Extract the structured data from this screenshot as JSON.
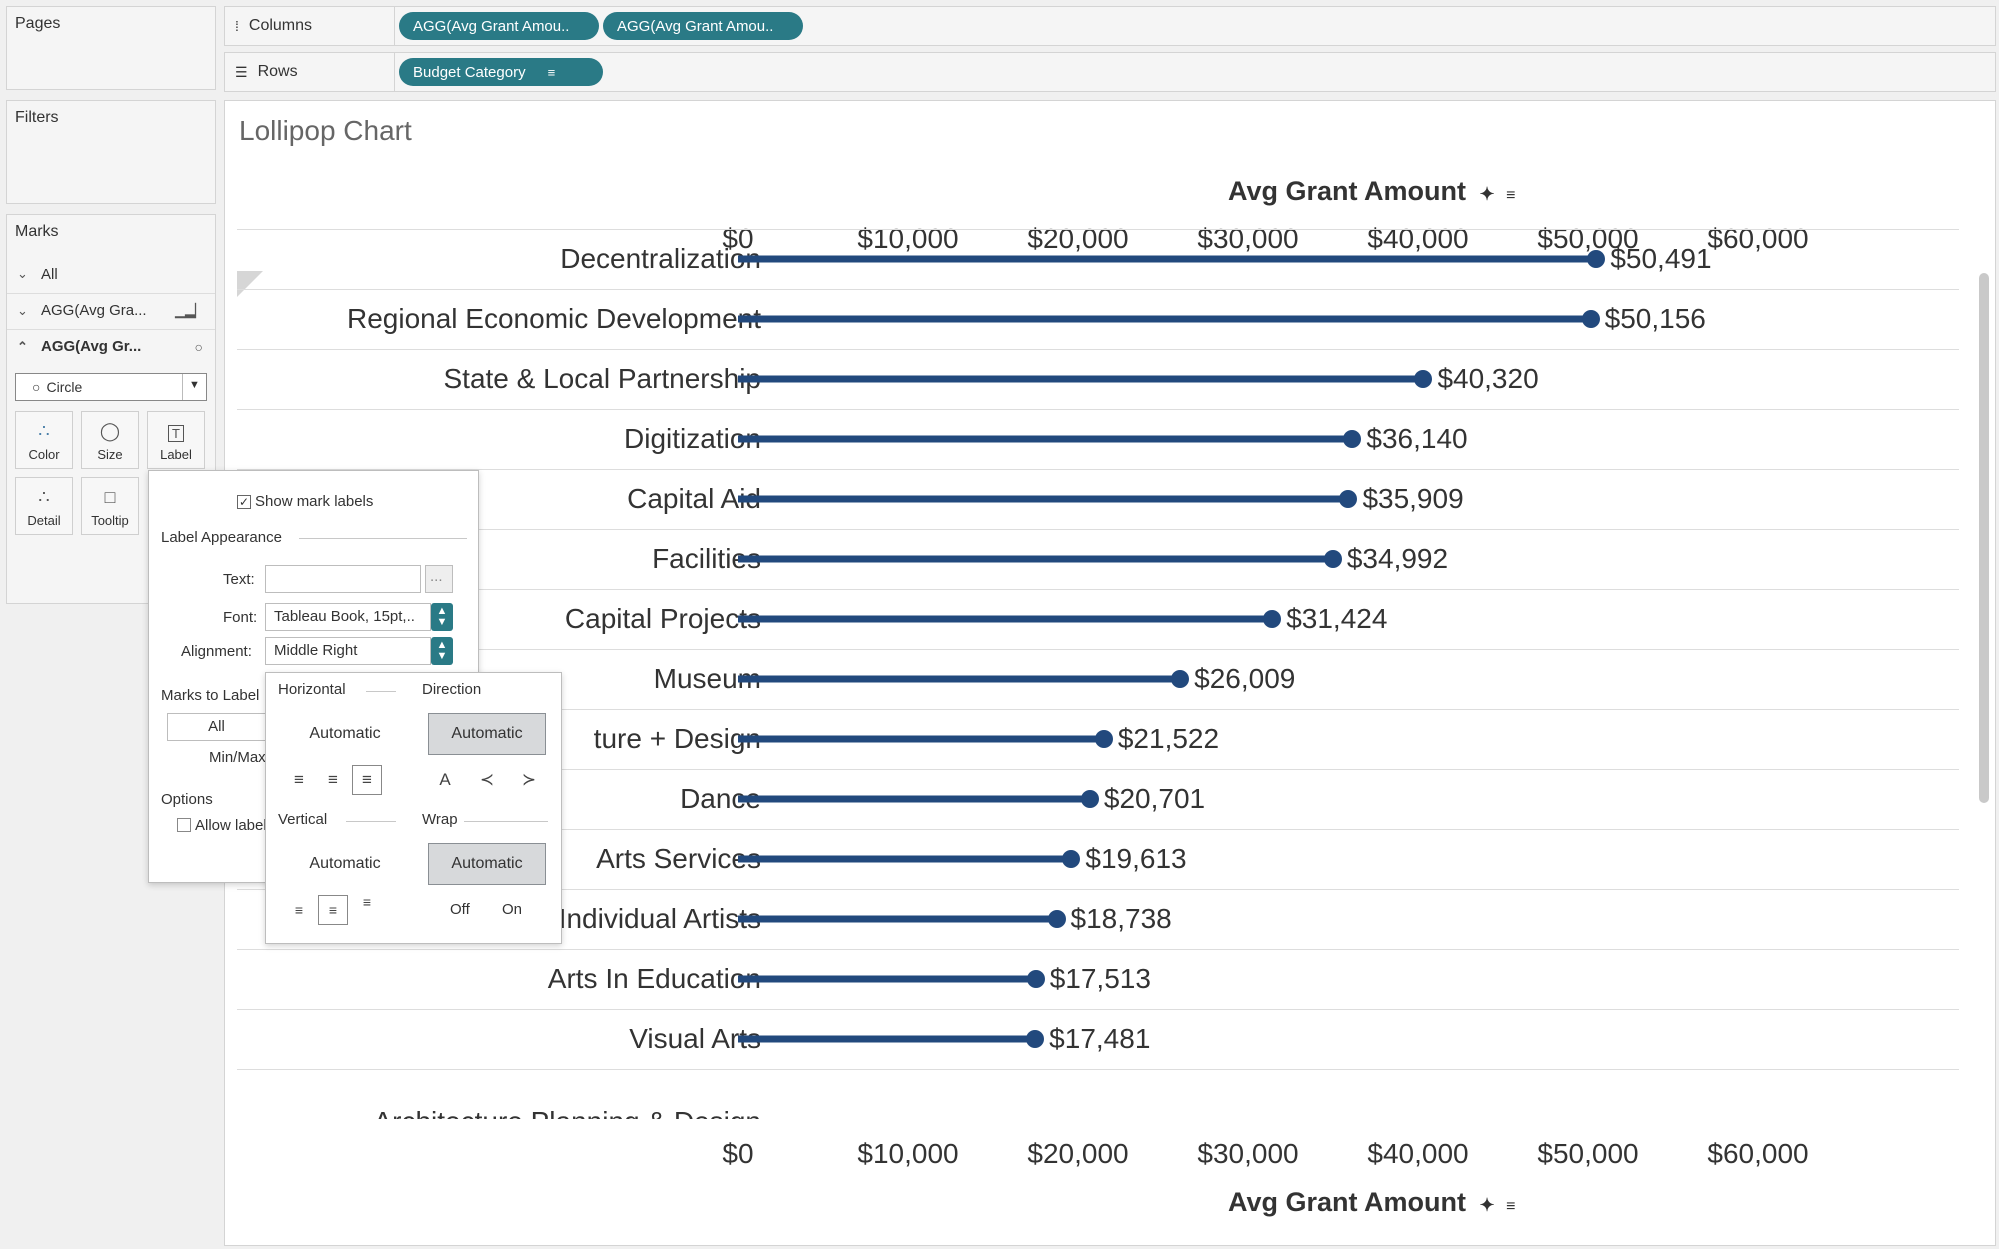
{
  "left_panel": {
    "pages_title": "Pages",
    "filters_title": "Filters",
    "marks_title": "Marks",
    "marks_cards": [
      {
        "label": "All",
        "icon": "chevron-down-icon"
      },
      {
        "label": "AGG(Avg Gra...",
        "icon": "bar-chart-icon"
      },
      {
        "label": "AGG(Avg Gr...",
        "icon": "circle-icon"
      }
    ],
    "mark_type": "Circle",
    "buttons": [
      "Color",
      "Size",
      "Label",
      "Detail",
      "Tooltip"
    ]
  },
  "shelves": {
    "columns_label": "Columns",
    "rows_label": "Rows",
    "column_pills": [
      "AGG(Avg Grant Amou..",
      "AGG(Avg Grant Amou.."
    ],
    "row_pills": [
      "Budget Category"
    ]
  },
  "view": {
    "title": "Lollipop Chart",
    "axis_title": "Avg Grant Amount",
    "partial_bottom_category": "Architecture Planning & Design"
  },
  "chart_data": {
    "type": "bar",
    "title": "Lollipop Chart",
    "xlabel": "Avg Grant Amount",
    "ylabel": "",
    "xlim": [
      0,
      60000
    ],
    "tick_labels": [
      "$0",
      "$10,000",
      "$20,000",
      "$30,000",
      "$40,000",
      "$50,000",
      "$60,000"
    ],
    "ticks": [
      0,
      10000,
      20000,
      30000,
      40000,
      50000,
      60000
    ],
    "categories": [
      "Decentralization",
      "Regional Economic Development",
      "State & Local Partnership",
      "Digitization",
      "Capital Aid",
      "Facilities",
      "Capital Projects",
      "Museum",
      "ture + Design",
      "Dance",
      "Arts Services",
      "Individual Artists",
      "Arts In Education",
      "Visual Arts"
    ],
    "values": [
      50491,
      50156,
      40320,
      36140,
      35909,
      34992,
      31424,
      26009,
      21522,
      20701,
      19613,
      18738,
      17513,
      17481
    ],
    "value_labels": [
      "$50,491",
      "$50,156",
      "$40,320",
      "$36,140",
      "$35,909",
      "$34,992",
      "$31,424",
      "$26,009",
      "$21,522",
      "$20,701",
      "$19,613",
      "$18,738",
      "$17,513",
      "$17,481"
    ],
    "color": "#22497d"
  },
  "label_popup": {
    "show_labels": "Show mark labels",
    "section_appearance": "Label Appearance",
    "text_label": "Text:",
    "text_btn": "...",
    "font_label": "Font:",
    "font_value": "Tableau Book, 15pt,..",
    "alignment_label": "Alignment:",
    "alignment_value": "Middle Right",
    "marks_to_label": "Marks to Label",
    "all_option": "All",
    "minmax": "Min/Max",
    "options": "Options",
    "allow_labels": "Allow labels"
  },
  "alignment_popup": {
    "horizontal": "Horizontal",
    "direction": "Direction",
    "vertical": "Vertical",
    "wrap": "Wrap",
    "automatic": "Automatic",
    "off": "Off",
    "on": "On"
  }
}
